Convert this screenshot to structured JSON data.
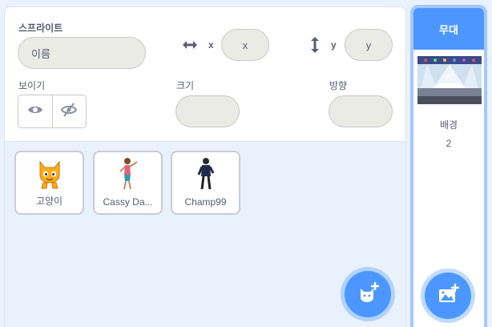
{
  "sprite_info": {
    "sprite_label": "스프라이트",
    "name_placeholder": "이름",
    "x_letter": "x",
    "x_placeholder": "x",
    "y_letter": "y",
    "y_placeholder": "y",
    "show_label": "보이기",
    "size_label": "크기",
    "direction_label": "방향"
  },
  "sprites": [
    {
      "name": "고양이",
      "icon": "cat-sprite"
    },
    {
      "name": "Cassy Da...",
      "icon": "cassy-dancer-sprite"
    },
    {
      "name": "Champ99",
      "icon": "champ99-sprite"
    }
  ],
  "stage": {
    "title": "무대",
    "backdrops_label": "배경",
    "backdrops_count": "2"
  },
  "colors": {
    "accent": "#4c97ff",
    "pane_bg": "#e9f1fc",
    "text": "#575e75"
  }
}
